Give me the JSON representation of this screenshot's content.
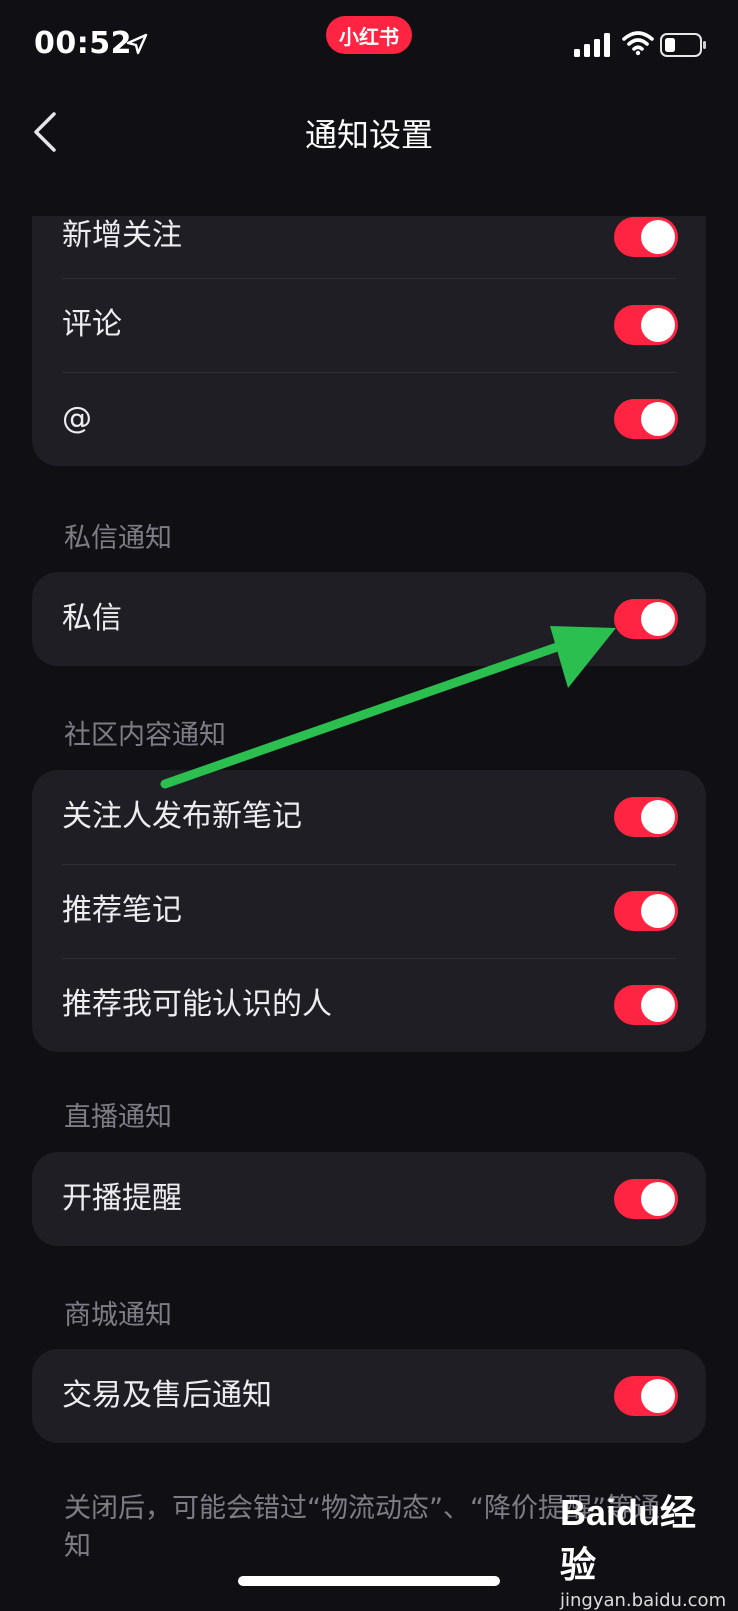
{
  "status_bar": {
    "time": "00:52",
    "app_badge": "小红书",
    "icons": [
      "location-arrow-icon",
      "signal-icon",
      "wifi-icon",
      "battery-icon"
    ]
  },
  "header": {
    "title": "通知设置",
    "back_icon": "chevron-left-icon"
  },
  "groups": [
    {
      "header": "",
      "items": [
        {
          "label": "新增关注",
          "enabled": true
        },
        {
          "label": "评论",
          "enabled": true
        },
        {
          "label": "@",
          "enabled": true
        }
      ]
    },
    {
      "header": "私信通知",
      "items": [
        {
          "label": "私信",
          "enabled": true
        }
      ]
    },
    {
      "header": "社区内容通知",
      "items": [
        {
          "label": "关注人发布新笔记",
          "enabled": true
        },
        {
          "label": "推荐笔记",
          "enabled": true
        },
        {
          "label": "推荐我可能认识的人",
          "enabled": true
        }
      ]
    },
    {
      "header": "直播通知",
      "items": [
        {
          "label": "开播提醒",
          "enabled": true
        }
      ]
    },
    {
      "header": "商城通知",
      "items": [
        {
          "label": "交易及售后通知",
          "enabled": true
        }
      ]
    }
  ],
  "footnote": "关闭后，可能会错过“物流动态”、“降价提醒”等通知",
  "watermark": {
    "logo": "Baidu经验",
    "url": "jingyan.baidu.com"
  },
  "colors": {
    "background": "#0f0f14",
    "card": "#1f1e24",
    "toggle_on": "#ff2442",
    "annotation_arrow": "#2bbf4f"
  }
}
